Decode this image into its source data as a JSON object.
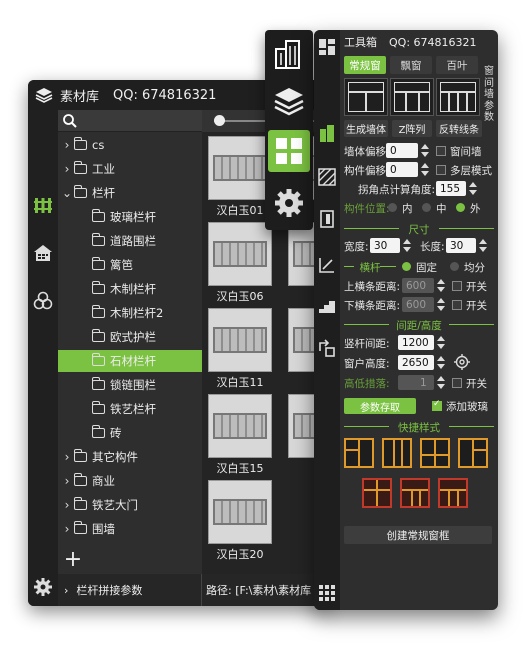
{
  "library": {
    "title": "素材库",
    "qq": "QQ: 674816321",
    "tree": [
      {
        "label": "cs",
        "expanded": false,
        "level": 0
      },
      {
        "label": "工业",
        "expanded": false,
        "level": 0
      },
      {
        "label": "栏杆",
        "expanded": true,
        "level": 0
      },
      {
        "label": "玻璃栏杆",
        "level": 1
      },
      {
        "label": "道路围栏",
        "level": 1
      },
      {
        "label": "篱笆",
        "level": 1
      },
      {
        "label": "木制栏杆",
        "level": 1
      },
      {
        "label": "木制栏杆2",
        "level": 1
      },
      {
        "label": "欧式护栏",
        "level": 1
      },
      {
        "label": "石材栏杆",
        "level": 1,
        "selected": true
      },
      {
        "label": "锁链围栏",
        "level": 1
      },
      {
        "label": "铁艺栏杆",
        "level": 1
      },
      {
        "label": "砖",
        "level": 1
      },
      {
        "label": "其它构件",
        "expanded": false,
        "level": 0
      },
      {
        "label": "商业",
        "expanded": false,
        "level": 0
      },
      {
        "label": "铁艺大门",
        "expanded": false,
        "level": 0
      },
      {
        "label": "围墙",
        "expanded": false,
        "level": 0
      }
    ],
    "thumbs": [
      "汉白玉01",
      "汉白玉06",
      "汉白玉11",
      "汉白玉15",
      "汉白玉20"
    ],
    "thumbs_right": [
      "汉",
      "汉",
      "汉",
      "汉"
    ],
    "footer_param": "栏杆拼接参数",
    "footer_path": "路径: [F:\\素材\\素材库"
  },
  "toolbox": {
    "title": "工具箱",
    "qq": "QQ: 674816321",
    "tabs": [
      "常规窗",
      "飘窗",
      "百叶"
    ],
    "side_tab": "窗间墙参数",
    "actions": [
      "生成墙体",
      "Z阵列",
      "反转线条"
    ],
    "wall_offset_label": "墙体偏移:",
    "wall_offset": "0",
    "between_wall_label": "窗间墙",
    "comp_offset_label": "构件偏移:",
    "comp_offset": "0",
    "multi_style_label": "多层模式",
    "corner_label": "拐角点计算角度:",
    "corner_value": "155",
    "comp_pos_label": "构件位置:",
    "comp_pos_options": [
      "内",
      "中",
      "外"
    ],
    "size_section": "尺寸",
    "width_label": "宽度:",
    "width_value": "30",
    "length_label": "长度:",
    "length_value": "30",
    "rail_label": "横杆",
    "rail_fixed": "固定",
    "rail_even": "均分",
    "upper_label": "上横条距离:",
    "upper_value": "600",
    "lower_label": "下横条距离:",
    "lower_value": "600",
    "switch_label": "开关",
    "spacing_section": "间距/高度",
    "post_spacing_label": "竖杆间距:",
    "post_spacing_value": "1200",
    "window_height_label": "窗户高度:",
    "window_height_value": "2650",
    "low_dist_label": "高低措落:",
    "low_dist_value": "1",
    "access_btn": "参数存取",
    "add_glass_label": "添加玻璃",
    "quick_section": "快捷样式",
    "create_btn": "创建常规窗框"
  },
  "colors": {
    "accent": "#7cc242",
    "panel": "#2b2b2b",
    "quick_orange": "#e09a2a",
    "quick_red": "#c0392b"
  }
}
